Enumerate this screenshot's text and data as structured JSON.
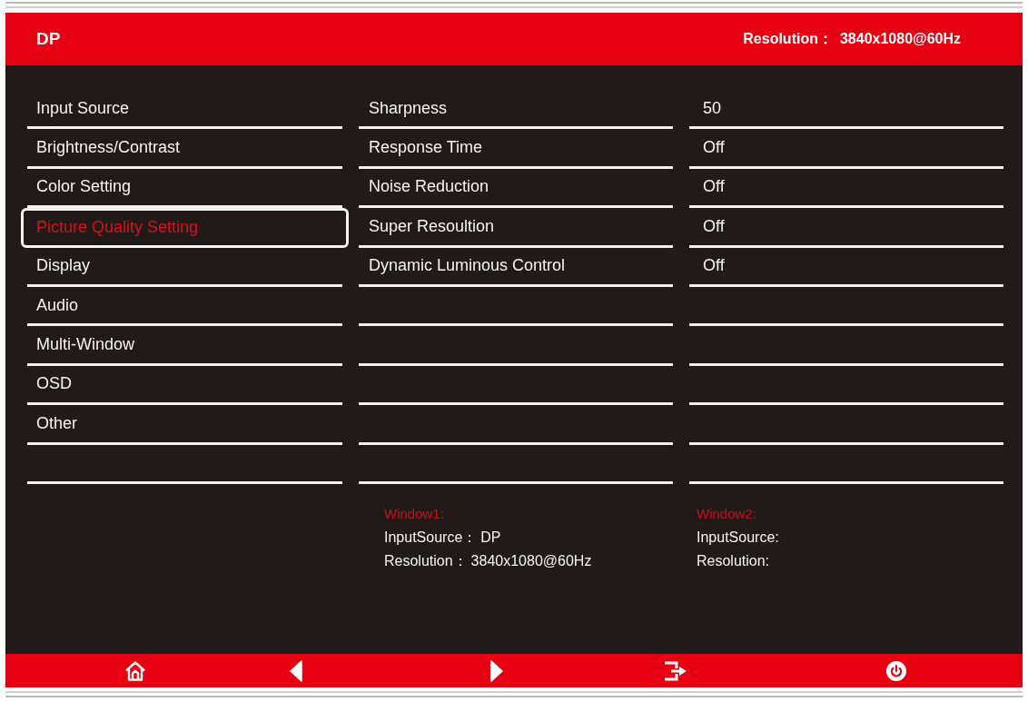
{
  "header": {
    "source": "DP",
    "resolution_label": "Resolution：",
    "resolution": "3840x1080@60Hz"
  },
  "menu": [
    {
      "label": "Input Source",
      "selected": false
    },
    {
      "label": "Brightness/Contrast",
      "selected": false
    },
    {
      "label": "Color Setting",
      "selected": false
    },
    {
      "label": "Picture Quality Setting",
      "selected": true
    },
    {
      "label": "Display",
      "selected": false
    },
    {
      "label": "Audio",
      "selected": false
    },
    {
      "label": "Multi-Window",
      "selected": false
    },
    {
      "label": "OSD",
      "selected": false
    },
    {
      "label": "Other",
      "selected": false
    }
  ],
  "settings": [
    {
      "name": "Sharpness",
      "value": "50"
    },
    {
      "name": "Response Time",
      "value": "Off"
    },
    {
      "name": "Noise Reduction",
      "value": "Off"
    },
    {
      "name": "Super Resoultion",
      "value": "Off"
    },
    {
      "name": "Dynamic Luminous Control",
      "value": "Off"
    }
  ],
  "windows": [
    {
      "title": "Window1:",
      "input_source_label": "InputSource：",
      "input_source": "DP",
      "resolution_label": "Resolution：",
      "resolution": "3840x1080@60Hz"
    },
    {
      "title": "Window2:",
      "input_source_label": "InputSource:",
      "resolution_label": "Resolution:"
    }
  ],
  "footer_buttons": [
    {
      "kind": "home"
    },
    {
      "kind": "left"
    },
    {
      "kind": "right"
    },
    {
      "kind": "exit"
    },
    {
      "kind": "power"
    }
  ]
}
